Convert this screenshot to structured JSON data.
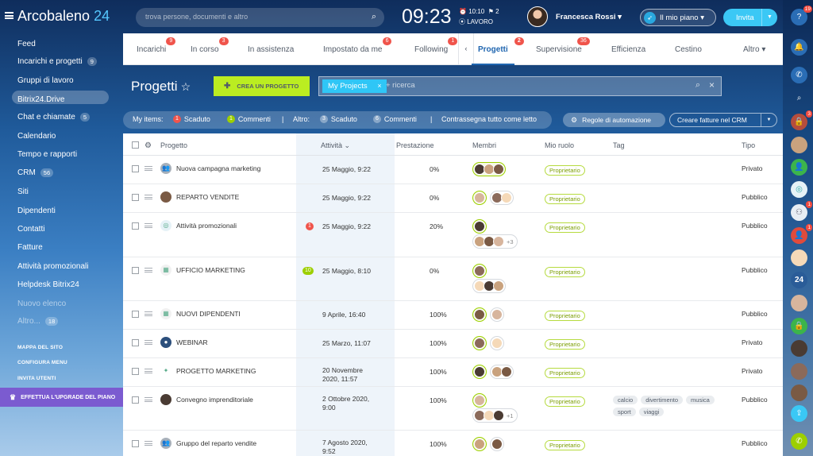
{
  "app": {
    "name": "Arcobaleno",
    "num": "24"
  },
  "search": {
    "placeholder": "trova persone, documenti e altro"
  },
  "clock": {
    "time": "09:23",
    "alarm": "10:10",
    "flags": "2",
    "status": "LAVORO"
  },
  "user": {
    "name": "Francesca Rossi"
  },
  "header": {
    "my_plan": "Il mio piano",
    "invite": "Invita"
  },
  "sidebar": {
    "items": [
      {
        "label": "Feed"
      },
      {
        "label": "Incarichi e progetti",
        "count": "9"
      },
      {
        "label": "Gruppi di lavoro"
      },
      {
        "label": "Bitrix24.Drive"
      },
      {
        "label": "Chat e chiamate",
        "count": "5"
      },
      {
        "label": "Calendario"
      },
      {
        "label": "Tempo e rapporti"
      },
      {
        "label": "CRM",
        "count": "56"
      },
      {
        "label": "Siti"
      },
      {
        "label": "Dipendenti"
      },
      {
        "label": "Contatti"
      },
      {
        "label": "Fatture"
      },
      {
        "label": "Attività promozionali"
      },
      {
        "label": "Helpdesk Bitrix24"
      },
      {
        "label": "Nuovo elenco"
      },
      {
        "label": "Altro...",
        "count": "18"
      }
    ],
    "links": [
      "MAPPA DEL SITO",
      "CONFIGURA MENU",
      "INVITA UTENTI"
    ],
    "upgrade": "EFFETTUA L'UPGRADE DEL PIANO"
  },
  "right_bar": {
    "help_badge": "19",
    "lock_badge": "3",
    "users_badge": "1",
    "user_badge": "1",
    "badge_24": "24"
  },
  "tabs": [
    {
      "label": "Incarichi",
      "badge": "9"
    },
    {
      "label": "In corso",
      "badge": "3"
    },
    {
      "label": "In assistenza"
    },
    {
      "label": "Impostato da me",
      "badge": "6"
    },
    {
      "label": "Following",
      "badge": "1"
    },
    {
      "label": "Progetti",
      "badge": "2"
    },
    {
      "label": "Supervisione",
      "badge": "36"
    },
    {
      "label": "Efficienza"
    },
    {
      "label": "Cestino"
    },
    {
      "label": "Altro"
    }
  ],
  "page": {
    "title": "Progetti",
    "new_project": "CREA UN PROGETTO"
  },
  "filter": {
    "chip": "My Projects",
    "placeholder": "+ ricerca"
  },
  "counters": {
    "my_items": "My items:",
    "overdue_count": "1",
    "overdue": "Scaduto",
    "comments_count": "1",
    "comments": "Commenti",
    "other": "Altro:",
    "other_overdue_count": "3",
    "other_overdue": "Scaduto",
    "other_comments_count": "6",
    "other_comments": "Commenti",
    "mark_all": "Contrassegna tutto come letto"
  },
  "buttons": {
    "automation": "Regole di automazione",
    "invoices": "Creare fatture nel CRM"
  },
  "columns": {
    "project": "Progetto",
    "activity": "Attività",
    "performance": "Prestazione",
    "members": "Membri",
    "role": "Mio ruolo",
    "tags": "Tag",
    "type": "Tipo"
  },
  "rows": [
    {
      "name": "Nuova campagna marketing",
      "activity": "25 Maggio, 9:22",
      "perf": "0%",
      "role": "Proprietario",
      "type": "Privato"
    },
    {
      "name": "REPARTO VENDITE",
      "activity": "25 Maggio, 9:22",
      "perf": "0%",
      "role": "Proprietario",
      "type": "Pubblico"
    },
    {
      "name": "Attività promozionali",
      "badge": "1",
      "activity": "25 Maggio, 9:22",
      "perf": "20%",
      "more": "+3",
      "role": "Proprietario",
      "type": "Pubblico"
    },
    {
      "name": "UFFICIO MARKETING",
      "badge": "10",
      "activity": "25 Maggio, 8:10",
      "perf": "0%",
      "role": "Proprietario",
      "type": "Pubblico"
    },
    {
      "name": "NUOVI DIPENDENTI",
      "activity": "9 Aprile, 16:40",
      "perf": "100%",
      "role": "Proprietario",
      "type": "Pubblico"
    },
    {
      "name": "WEBINAR",
      "activity": "25 Marzo, 11:07",
      "perf": "100%",
      "role": "Proprietario",
      "type": "Privato"
    },
    {
      "name": "PROGETTO MARKETING",
      "activity_l1": "20 Novembre",
      "activity_l2": "2020, 11:57",
      "perf": "100%",
      "role": "Proprietario",
      "type": "Privato"
    },
    {
      "name": "Convegno imprenditoriale",
      "activity_l1": "2 Ottobre 2020,",
      "activity_l2": "9:00",
      "perf": "100%",
      "more": "+1",
      "role": "Proprietario",
      "tags": [
        "calcio",
        "divertimento",
        "musica",
        "sport",
        "viaggi"
      ],
      "type": "Pubblico"
    },
    {
      "name": "Gruppo del reparto vendite",
      "activity_l1": "7 Agosto 2020,",
      "activity_l2": "9:52",
      "perf": "100%",
      "role": "Proprietario",
      "type": "Pubblico"
    }
  ]
}
